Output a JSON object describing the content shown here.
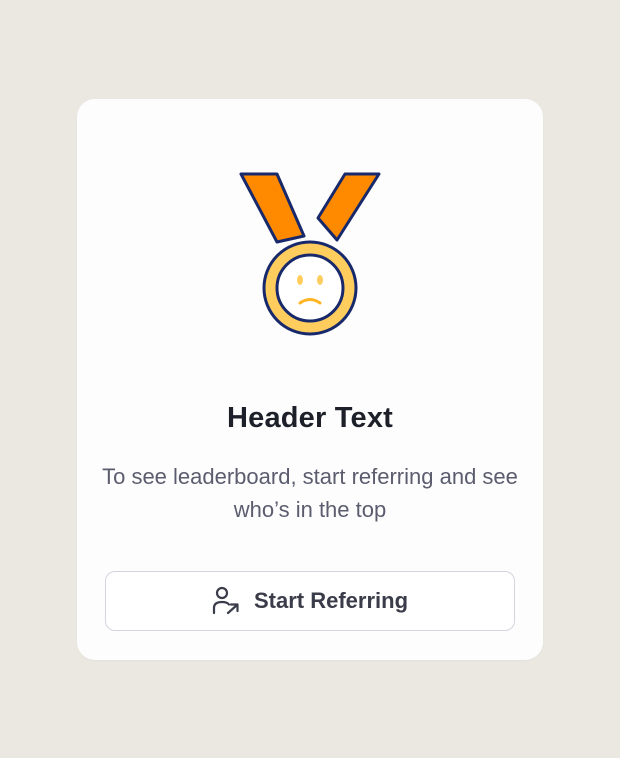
{
  "empty_state": {
    "icon": "sad-medal-icon",
    "title": "Header Text",
    "description": "To see leaderboard, start referring and see who’s in the top",
    "button": {
      "label": "Start Referring",
      "icon": "user-share-icon"
    }
  },
  "colors": {
    "background": "#ebe8e2",
    "card": "#fdfdfe",
    "ribbon": "#ff8a00",
    "medal_ring": "#ffcd5e",
    "outline": "#17296b",
    "title_text": "#1d1f29",
    "body_text": "#5b5d6e",
    "button_border": "#d3d4df",
    "button_text": "#3a3c4a"
  }
}
